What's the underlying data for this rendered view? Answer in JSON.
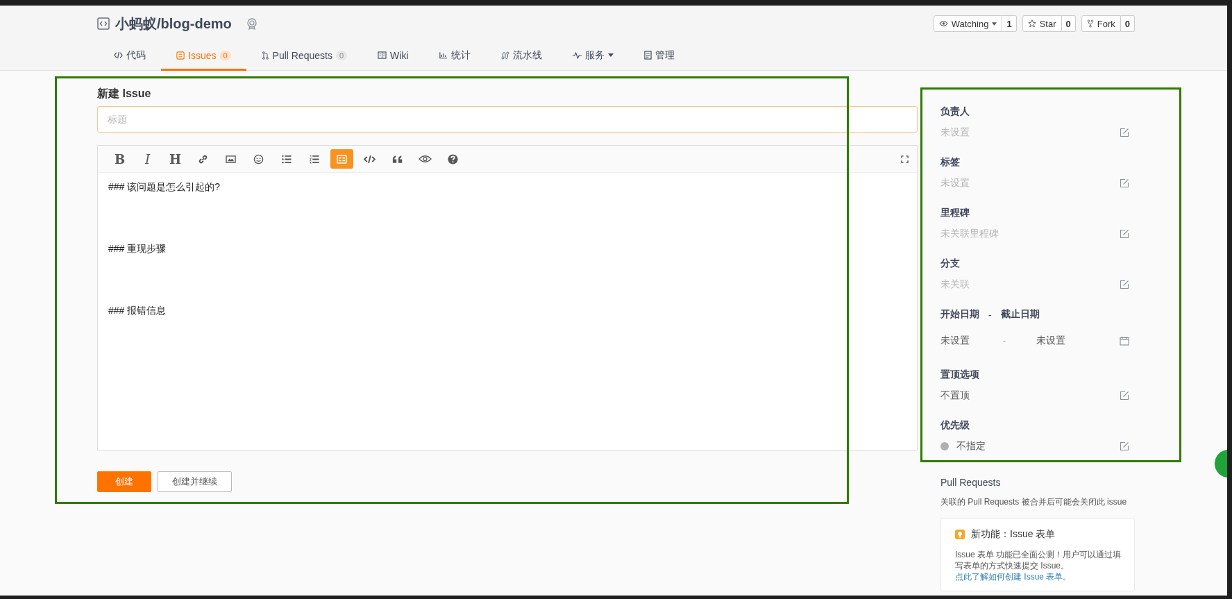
{
  "repo": {
    "name": "小蚂蚁/blog-demo"
  },
  "repo_actions": [
    {
      "kind": "watch",
      "label": "Watching",
      "count": "1"
    },
    {
      "kind": "star",
      "label": "Star",
      "count": "0"
    },
    {
      "kind": "fork",
      "label": "Fork",
      "count": "0"
    }
  ],
  "tabs": [
    {
      "kind": "code",
      "label": "代码",
      "selected": false
    },
    {
      "kind": "issues",
      "label": "Issues",
      "count": "0",
      "selected": true
    },
    {
      "kind": "pr",
      "label": "Pull Requests",
      "count": "0",
      "selected": false
    },
    {
      "kind": "wiki",
      "label": "Wiki",
      "selected": false
    },
    {
      "kind": "stats",
      "label": "统计",
      "selected": false
    },
    {
      "kind": "pipeline",
      "label": "流水线",
      "selected": false
    },
    {
      "kind": "service",
      "label": "服务",
      "dropdown": true,
      "selected": false
    },
    {
      "kind": "manage",
      "label": "管理",
      "selected": false
    }
  ],
  "form": {
    "heading": "新建 Issue",
    "title_placeholder": "标题",
    "toolbar": [
      {
        "kind": "bold",
        "glyph": "B",
        "selected": false
      },
      {
        "kind": "italic",
        "glyph": "I",
        "selected": false
      },
      {
        "kind": "heading",
        "glyph": "H",
        "selected": false
      },
      {
        "kind": "link",
        "selected": false
      },
      {
        "kind": "image",
        "selected": false
      },
      {
        "kind": "emoji",
        "selected": false
      },
      {
        "kind": "ul",
        "selected": false
      },
      {
        "kind": "ol",
        "selected": false
      },
      {
        "kind": "table",
        "selected": true
      },
      {
        "kind": "code",
        "selected": false
      },
      {
        "kind": "quote",
        "selected": false
      },
      {
        "kind": "preview",
        "selected": false
      },
      {
        "kind": "help",
        "selected": false
      }
    ],
    "body_lines": [
      "### 该问题是怎么引起的?",
      "### 重现步骤",
      "### 报错信息"
    ],
    "buttons": [
      {
        "kind": "primary",
        "label": "创建"
      },
      {
        "kind": "default",
        "label": "创建并继续"
      }
    ]
  },
  "sidebar": {
    "fields": [
      {
        "kind": "edit",
        "title": "负责人",
        "value": "未设置",
        "muted": true
      },
      {
        "kind": "edit",
        "title": "标签",
        "value": "未设置",
        "muted": true
      },
      {
        "kind": "edit",
        "title": "里程碑",
        "value": "未关联里程碑",
        "muted": true
      },
      {
        "kind": "edit",
        "title": "分支",
        "value": "未关联",
        "muted": true
      },
      {
        "kind": "date",
        "title": "开始日期",
        "separator": "-",
        "title_2": "截止日期",
        "value": "未设置",
        "value_separator": "-",
        "value_2": "未设置"
      },
      {
        "kind": "edit",
        "title": "置顶选项",
        "value": "不置顶",
        "muted": false
      },
      {
        "kind": "priority",
        "title": "优先级",
        "value": "不指定",
        "color": "#b0b0b0"
      }
    ],
    "pull_requests": {
      "title": "Pull Requests",
      "note": "关联的 Pull Requests 被合并后可能会关闭此 issue"
    },
    "notice": {
      "title": "新功能：Issue 表单",
      "text": "Issue 表单 功能已全面公测！用户可以通过填写表单的方式快速提交 Issue。",
      "link": "点此了解如何创建 Issue 表单。"
    }
  }
}
